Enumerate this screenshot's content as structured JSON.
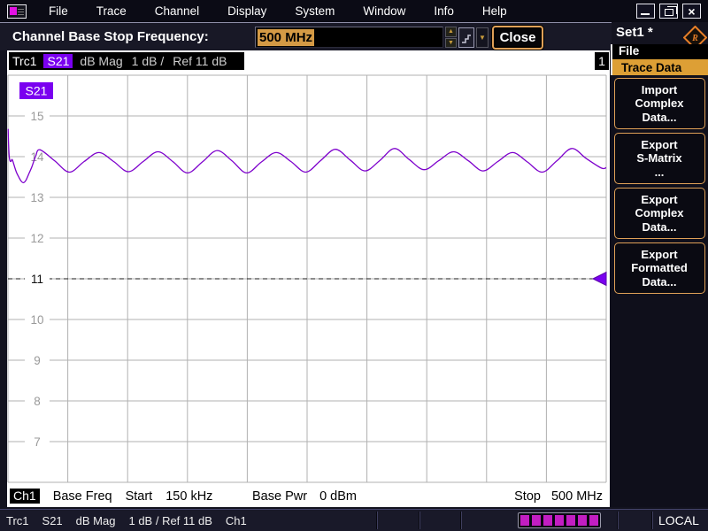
{
  "menu_bar": {
    "items": [
      "File",
      "Trace",
      "Channel",
      "Display",
      "System",
      "Window",
      "Info",
      "Help"
    ]
  },
  "window_controls": {
    "close_glyph": "×"
  },
  "toolbar": {
    "label": "Channel Base Stop Frequency:",
    "input_value": "500 MHz",
    "close_label": "Close"
  },
  "setup": {
    "name": "Set1 *"
  },
  "trace_header": {
    "trace": "Trc1",
    "meas": "S21",
    "format": "dB Mag",
    "scale": "1 dB /",
    "ref": "Ref 11 dB",
    "window_number": "1"
  },
  "channel_footer": {
    "channel": "Ch1",
    "base_freq_label": "Base Freq",
    "start_label": "Start",
    "start_value": "150 kHz",
    "base_pwr_label": "Base Pwr",
    "base_pwr_value": "0 dBm",
    "stop_label": "Stop",
    "stop_value": "500 MHz"
  },
  "sidebar": {
    "menu_title": "File",
    "submenu_title": "Trace Data",
    "buttons": [
      {
        "id": "import-complex-data",
        "lines": [
          "Import",
          "Complex",
          "Data..."
        ]
      },
      {
        "id": "export-s-matrix",
        "lines": [
          "Export",
          "S-Matrix",
          "..."
        ]
      },
      {
        "id": "export-complex-data",
        "lines": [
          "Export",
          "Complex",
          "Data..."
        ]
      },
      {
        "id": "export-formatted-data",
        "lines": [
          "Export",
          "Formatted",
          "Data..."
        ]
      }
    ]
  },
  "status_bar": {
    "items": [
      "Trc1",
      "S21",
      "dB Mag",
      "1 dB / Ref 11 dB",
      "Ch1"
    ],
    "progress_segments": 7,
    "mode": "LOCAL"
  },
  "colors": {
    "accent_orange": "#dfa057",
    "selection_orange": "#d49a45",
    "trace_purple": "#7d00cc",
    "badge_purple": "#7a00f0",
    "progress_magenta": "#c21ec2",
    "grid_gray": "#b0b0b0",
    "label_gray": "#9a9a9a"
  },
  "chart_data": {
    "type": "line",
    "parameter": "S21",
    "format": "dB Mag",
    "scale_per_div_db": 1,
    "ref_level_db": 11,
    "x_axis": {
      "start_label": "150 kHz",
      "stop_label": "500 MHz",
      "start_mhz": 0.15,
      "stop_mhz": 500,
      "divisions": 10,
      "grid": true
    },
    "y_axis": {
      "min": 6,
      "max": 16,
      "gridline_values": [
        7,
        8,
        9,
        10,
        11,
        12,
        13,
        14,
        15
      ]
    },
    "series": [
      {
        "name": "S21 dB Mag",
        "x_mhz": [
          0.15,
          0.8,
          1.5,
          2.5,
          3.5,
          5,
          7,
          9,
          11,
          13,
          15,
          17,
          20,
          23,
          26.6,
          39,
          51.3,
          63.7,
          76,
          88.3,
          100.7,
          113,
          125.4,
          137.7,
          150,
          162.4,
          174.8,
          187.1,
          199.5,
          211.8,
          224.2,
          236.5,
          248.9,
          261.2,
          273.6,
          285.9,
          298.3,
          310.6,
          323,
          335.3,
          347.7,
          360,
          372.4,
          384.7,
          397,
          409.4,
          421.8,
          434.1,
          446.5,
          458.8,
          471.2,
          483.5,
          495.9,
          500
        ],
        "y_db": [
          14.68,
          14.1,
          13.92,
          13.88,
          13.93,
          13.8,
          13.62,
          13.5,
          13.4,
          13.36,
          13.42,
          13.55,
          13.75,
          14.0,
          14.17,
          13.9,
          13.62,
          13.88,
          14.1,
          13.88,
          13.63,
          13.88,
          14.12,
          13.88,
          13.6,
          13.87,
          14.15,
          13.9,
          13.6,
          13.87,
          14.1,
          13.88,
          13.62,
          13.9,
          14.18,
          13.92,
          13.65,
          13.9,
          14.2,
          13.93,
          13.68,
          13.9,
          14.12,
          13.9,
          13.65,
          13.88,
          14.1,
          13.87,
          13.62,
          13.9,
          14.2,
          13.95,
          13.72,
          13.73
        ]
      }
    ]
  }
}
